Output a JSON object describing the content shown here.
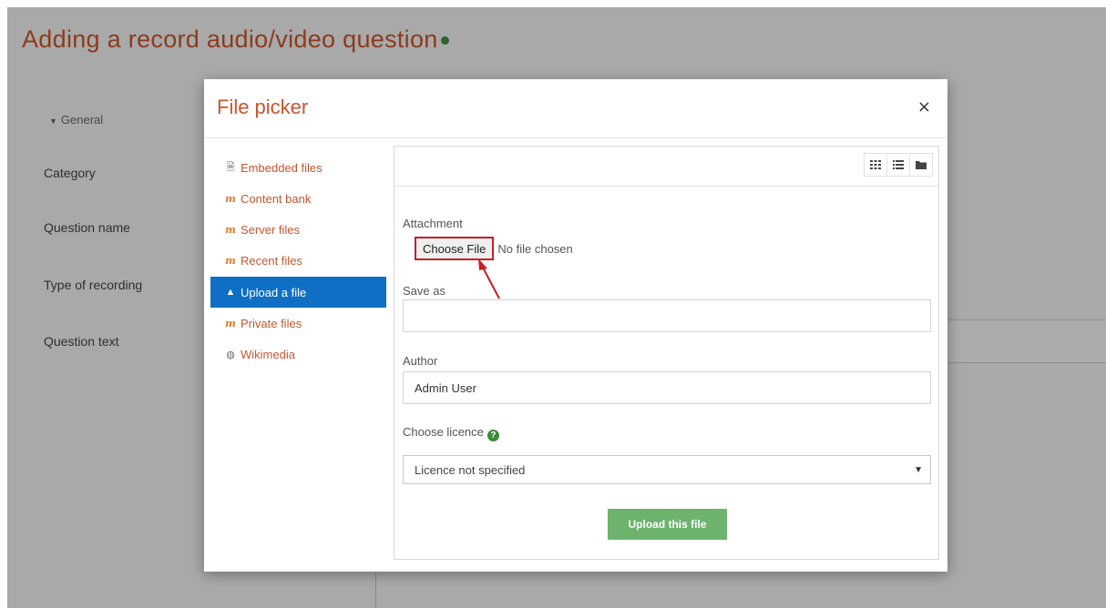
{
  "page": {
    "title": "Adding a record audio/video question",
    "form_labels": {
      "general": "General",
      "category": "Category",
      "question_name": "Question name",
      "type_of_recording": "Type of recording",
      "question_text": "Question text"
    }
  },
  "dialog": {
    "title": "File picker",
    "close_icon": "×",
    "repositories": [
      {
        "label": "Embedded files",
        "icon": "file-icon"
      },
      {
        "label": "Content bank",
        "icon": "moodle-icon"
      },
      {
        "label": "Server files",
        "icon": "moodle-icon"
      },
      {
        "label": "Recent files",
        "icon": "moodle-icon"
      },
      {
        "label": "Upload a file",
        "icon": "upload-icon",
        "active": true
      },
      {
        "label": "Private files",
        "icon": "moodle-icon"
      },
      {
        "label": "Wikimedia",
        "icon": "wikimedia-icon"
      }
    ],
    "view_buttons": [
      "grid-view-icon",
      "list-view-icon",
      "folder-view-icon"
    ],
    "form": {
      "attachment_label": "Attachment",
      "choose_file_button": "Choose File",
      "no_file_text": "No file chosen",
      "save_as_label": "Save as",
      "save_as_value": "",
      "author_label": "Author",
      "author_value": "Admin User",
      "licence_label": "Choose licence",
      "licence_selected": "Licence not specified",
      "upload_button": "Upload this file"
    }
  },
  "colors": {
    "accent": "#c8562d",
    "active_item": "#0f6fc5",
    "upload_button": "#6db36d",
    "highlight_box": "#c81e24"
  }
}
